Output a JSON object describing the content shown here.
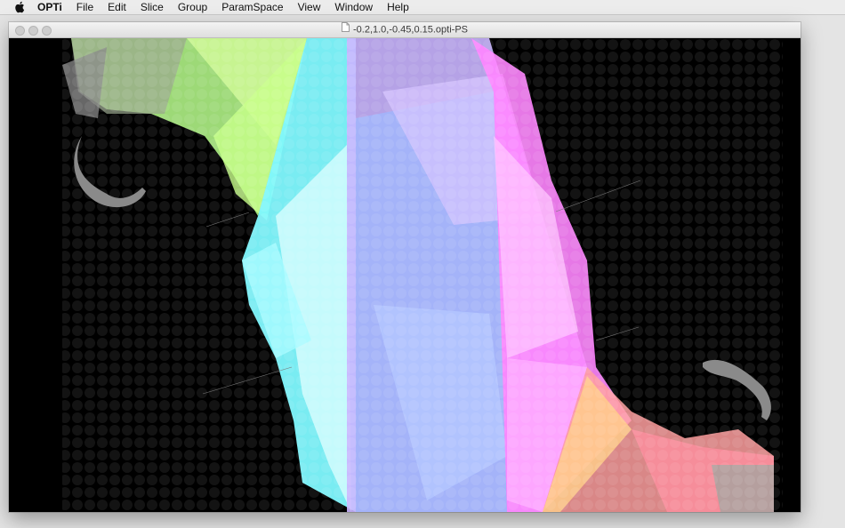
{
  "menubar": {
    "app_name": "OPTi",
    "items": [
      "File",
      "Edit",
      "Slice",
      "Group",
      "ParamSpace",
      "View",
      "Window",
      "Help"
    ]
  },
  "window": {
    "title": "-0.2,1.0,-0.45,0.15.opti-PS",
    "background": "#000000"
  },
  "icons": {
    "apple": "apple-icon",
    "document": "document-icon",
    "window_controls": [
      "close-button",
      "minimize-button",
      "zoom-button"
    ]
  },
  "colors": {
    "cyan": "#7ff9ff",
    "magenta": "#ff85ff",
    "lavender": "#c9a3ff",
    "blue": "#8fb5ff",
    "green": "#b8ff8c",
    "salmon": "#ff9f9f",
    "gray": "#8a8a8a"
  }
}
